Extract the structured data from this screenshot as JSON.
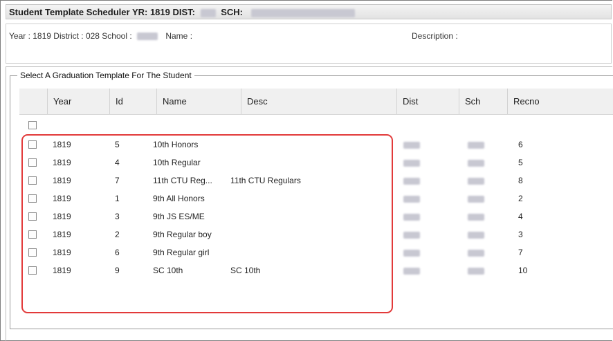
{
  "window": {
    "title_prefix": "Student Template Scheduler YR: 1819 DIST:",
    "sch_label": "SCH:"
  },
  "info": {
    "line": "Year : 1819  District : 028  School :",
    "name_label": "Name :",
    "description_label": "Description :"
  },
  "group": {
    "legend": "Select A Graduation Template For The Student"
  },
  "table": {
    "columns": [
      "Year",
      "Id",
      "Name",
      "Desc",
      "Dist",
      "Sch",
      "Recno"
    ],
    "rows": [
      {
        "year": "1819",
        "id": "5",
        "name": "10th Honors",
        "desc": "",
        "recno": "6"
      },
      {
        "year": "1819",
        "id": "4",
        "name": "10th Regular",
        "desc": "",
        "recno": "5"
      },
      {
        "year": "1819",
        "id": "7",
        "name": "11th CTU Reg...",
        "desc": "11th CTU Regulars",
        "recno": "8"
      },
      {
        "year": "1819",
        "id": "1",
        "name": "9th All Honors",
        "desc": "",
        "recno": "2"
      },
      {
        "year": "1819",
        "id": "3",
        "name": "9th JS ES/ME",
        "desc": "",
        "recno": "4"
      },
      {
        "year": "1819",
        "id": "2",
        "name": "9th Regular boy",
        "desc": "",
        "recno": "3"
      },
      {
        "year": "1819",
        "id": "6",
        "name": "9th Regular girl",
        "desc": "",
        "recno": "7"
      },
      {
        "year": "1819",
        "id": "9",
        "name": "SC 10th",
        "desc": "SC 10th",
        "recno": "10"
      }
    ]
  },
  "colors": {
    "highlight": "#e23a3a",
    "header_bg": "#f0f0f0"
  }
}
